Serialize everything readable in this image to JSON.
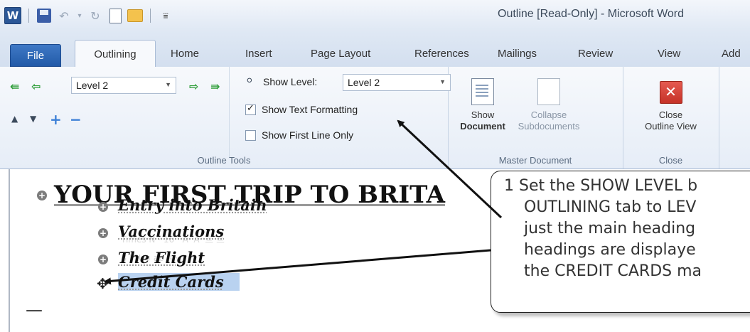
{
  "titlebar": {
    "title": "Outline [Read-Only] - Microsoft Word"
  },
  "tabs": [
    {
      "label": "File"
    },
    {
      "label": "Outlining"
    },
    {
      "label": "Home"
    },
    {
      "label": "Insert"
    },
    {
      "label": "Page Layout"
    },
    {
      "label": "References"
    },
    {
      "label": "Mailings"
    },
    {
      "label": "Review"
    },
    {
      "label": "View"
    },
    {
      "label": "Add"
    }
  ],
  "ribbon": {
    "outline_tools": {
      "level_value": "Level 2",
      "show_level_label": "Show Level:",
      "show_level_value": "Level 2",
      "show_text_formatting": "Show Text Formatting",
      "show_text_formatting_checked": true,
      "show_first_line_only": "Show First Line Only",
      "show_first_line_only_checked": false,
      "group_label": "Outline Tools"
    },
    "master_document": {
      "show_document_line1": "Show",
      "show_document_line2": "Document",
      "collapse_line1": "Collapse",
      "collapse_line2": "Subdocuments",
      "group_label": "Master Document"
    },
    "close": {
      "close_line1": "Close",
      "close_line2": "Outline View",
      "group_label": "Close"
    }
  },
  "document": {
    "heading1": "YOUR FIRST TRIP TO BRITA",
    "heading2": [
      "Entry into Britain",
      "Vaccinations",
      "The Flight",
      "Credit Cards"
    ],
    "end_mark": "—"
  },
  "callout": {
    "lines": [
      "1  Set the SHOW LEVEL b",
      "OUTLINING tab to LEV",
      "just the main heading",
      "headings are displaye",
      "the CREDIT CARDS ma"
    ]
  }
}
